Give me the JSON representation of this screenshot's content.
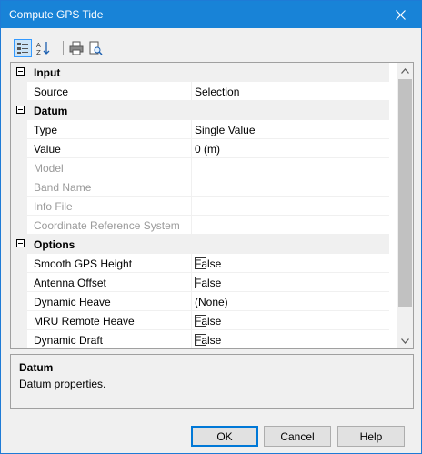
{
  "window": {
    "title": "Compute GPS Tide"
  },
  "toolbar": {
    "icons": [
      "categorized-icon",
      "alphabetical-sort-icon",
      "print-icon",
      "print-preview-icon"
    ]
  },
  "grid": {
    "categories": {
      "input": "Input",
      "datum": "Datum",
      "options": "Options"
    },
    "rows": {
      "source": {
        "name": "Source",
        "value": "Selection"
      },
      "type": {
        "name": "Type",
        "value": "Single Value"
      },
      "value": {
        "name": "Value",
        "value": "0 (m)"
      },
      "model": {
        "name": "Model",
        "value": ""
      },
      "band_name": {
        "name": "Band Name",
        "value": ""
      },
      "info_file": {
        "name": "Info File",
        "value": ""
      },
      "crs": {
        "name": "Coordinate Reference System",
        "value": ""
      },
      "smooth_gps_height": {
        "name": "Smooth GPS Height",
        "value": "False",
        "checked": false
      },
      "antenna_offset": {
        "name": "Antenna Offset",
        "value": "False",
        "checked": false
      },
      "dynamic_heave": {
        "name": "Dynamic Heave",
        "value": "(None)"
      },
      "mru_remote_heave": {
        "name": "MRU Remote Heave",
        "value": "False",
        "checked": false
      },
      "dynamic_draft": {
        "name": "Dynamic Draft",
        "value": "False",
        "checked": false
      }
    }
  },
  "description": {
    "title": "Datum",
    "text": "Datum properties."
  },
  "buttons": {
    "ok": "OK",
    "cancel": "Cancel",
    "help": "Help"
  },
  "colors": {
    "titlebar": "#1883d7",
    "accent": "#0078d7"
  }
}
